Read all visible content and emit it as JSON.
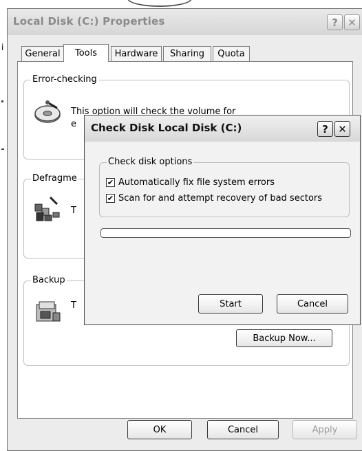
{
  "window": {
    "title": "Local Disk (C:) Properties",
    "help_btn": "?",
    "close_btn": "✕"
  },
  "tabs": [
    {
      "label": "General"
    },
    {
      "label": "Tools"
    },
    {
      "label": "Hardware"
    },
    {
      "label": "Sharing"
    },
    {
      "label": "Quota"
    }
  ],
  "active_tab": "Tools",
  "error_checking": {
    "title": "Error-checking",
    "text": "This option will check the volume for",
    "text_fragment": "e"
  },
  "defrag": {
    "title": "Defragme",
    "text_fragment": "T"
  },
  "backup": {
    "title": "Backup",
    "text_fragment": "T",
    "button": "Backup Now..."
  },
  "footer": {
    "ok": "OK",
    "cancel": "Cancel",
    "apply": "Apply"
  },
  "dialog": {
    "title": "Check Disk Local Disk (C:)",
    "help_btn": "?",
    "close_btn": "✕",
    "group_title": "Check disk options",
    "options": [
      {
        "label": "Automatically fix file system errors",
        "checked": true
      },
      {
        "label": "Scan for and attempt recovery of bad sectors",
        "checked": true
      }
    ],
    "progress": 0,
    "start": "Start",
    "cancel": "Cancel"
  },
  "stray_letters": [
    "i",
    "i"
  ]
}
